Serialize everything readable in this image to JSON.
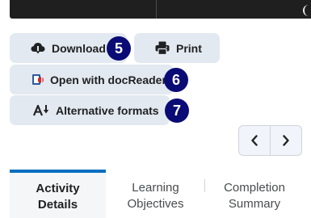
{
  "actions": {
    "download": {
      "label": "Download",
      "badge": "5"
    },
    "print": {
      "label": "Print"
    },
    "open_docreader": {
      "label": "Open with docReader",
      "badge": "6"
    },
    "alt_formats": {
      "label": "Alternative formats",
      "badge": "7"
    }
  },
  "tabs": [
    {
      "line1": "Activity",
      "line2": "Details",
      "active": true
    },
    {
      "line1": "Learning",
      "line2": "Objectives",
      "active": false
    },
    {
      "line1": "Completion",
      "line2": "Summary",
      "active": false
    }
  ],
  "colors": {
    "button_bg": "#e3e9f1",
    "badge_bg": "#0b0b75",
    "tab_accent": "#006fbf",
    "docreader_red": "#d12a2a",
    "docreader_blue": "#2c5aa0"
  },
  "icons": {
    "download": "cloud-download-icon",
    "print": "printer-icon",
    "docreader": "docreader-icon",
    "alt_formats": "alternative-formats-icon",
    "prev": "chevron-left-icon",
    "next": "chevron-right-icon"
  }
}
